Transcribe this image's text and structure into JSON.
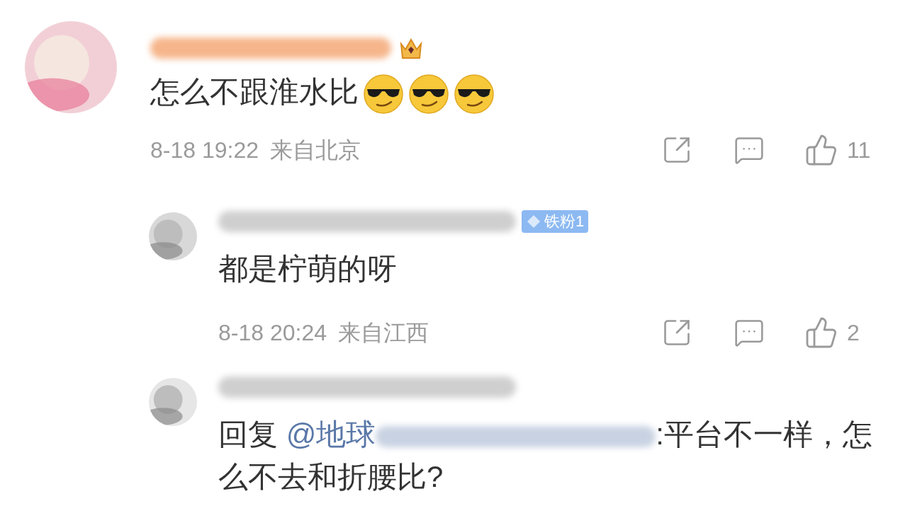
{
  "comments": [
    {
      "kind": "comment",
      "badge": {
        "kind": "crown"
      },
      "text": "怎么不跟淮水比",
      "emojis": [
        {
          "kind": "cool"
        },
        {
          "kind": "cool"
        },
        {
          "kind": "cool"
        }
      ],
      "time": "8-18 19:22",
      "location": "来自北京",
      "likes": "11"
    },
    {
      "kind": "reply",
      "badge": {
        "kind": "fan",
        "label": "铁粉1"
      },
      "text": "都是柠萌的呀",
      "time": "8-18 20:24",
      "location": "来自江西",
      "likes": "2"
    },
    {
      "kind": "reply",
      "reply_prefix": "回复 ",
      "mention": "@地球",
      "text": ":平台不一样，怎么不去和折腰比?"
    }
  ]
}
